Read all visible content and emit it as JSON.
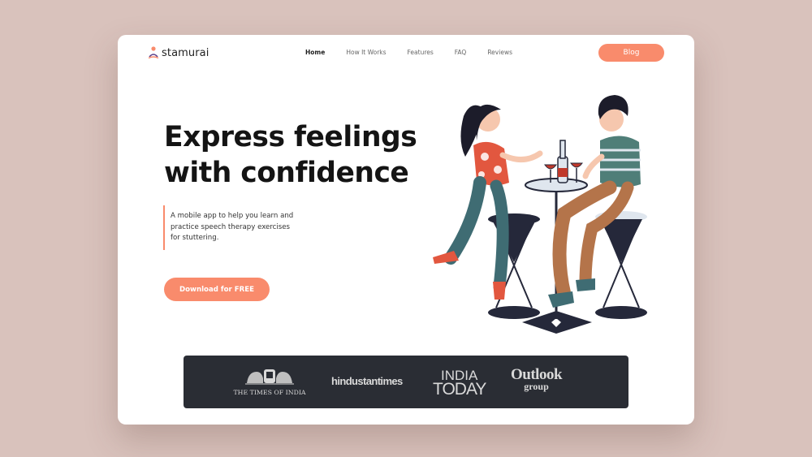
{
  "brand": {
    "name": "stamurai"
  },
  "nav": {
    "items": [
      {
        "label": "Home",
        "active": true
      },
      {
        "label": "How It Works",
        "active": false
      },
      {
        "label": "Features",
        "active": false
      },
      {
        "label": "FAQ",
        "active": false
      },
      {
        "label": "Reviews",
        "active": false
      }
    ]
  },
  "header": {
    "blog_label": "Blog"
  },
  "hero": {
    "title_line1": "Express feelings",
    "title_line2": "with confidence",
    "description_line1": "A mobile app to help you learn and",
    "description_line2": "practice speech therapy exercises",
    "description_line3": "for stuttering.",
    "cta_label": "Download for FREE"
  },
  "press": {
    "toi": "THE TIMES OF INDIA",
    "ht": "hindustantimes",
    "it_line1": "INDIA",
    "it_line2": "TODAY",
    "outlook_line1": "Outlook",
    "outlook_line2": "group"
  },
  "colors": {
    "accent": "#f98b6c",
    "background": "#d9c2bc",
    "press_bar": "#2a2d34"
  }
}
